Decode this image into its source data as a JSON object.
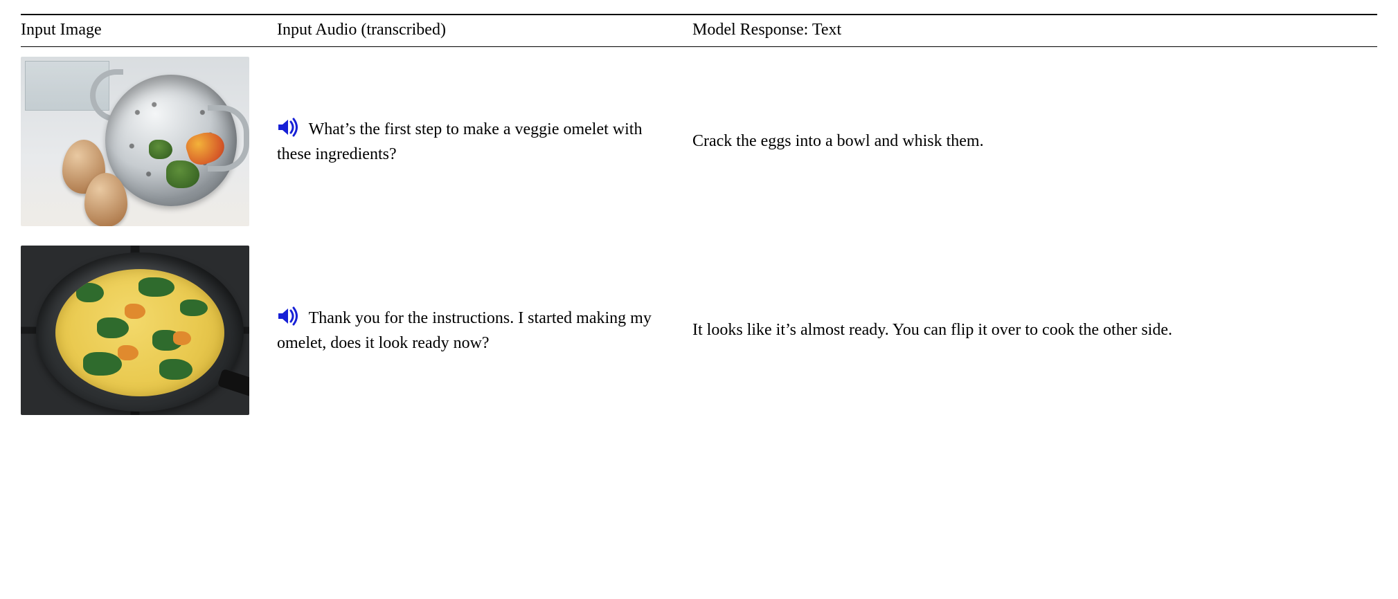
{
  "headers": {
    "image": "Input Image",
    "audio": "Input Audio (transcribed)",
    "response": "Model Response: Text"
  },
  "rows": [
    {
      "image_alt": "Two brown eggs next to a metal colander containing broccoli and small peppers on a countertop.",
      "audio_text": "What’s the first step to make a veggie omelet with these ingredients?",
      "response_text": "Crack the eggs into a bowl and whisk them."
    },
    {
      "image_alt": "A frying pan on a stove with a partially cooked veggie omelet (eggs with greens and orange vegetables).",
      "audio_text": "Thank you for the instructions. I started making my omelet, does it look ready now?",
      "response_text": "It looks like it’s almost ready. You can flip it over to cook the other side."
    }
  ],
  "icons": {
    "speaker": "speaker-icon"
  }
}
